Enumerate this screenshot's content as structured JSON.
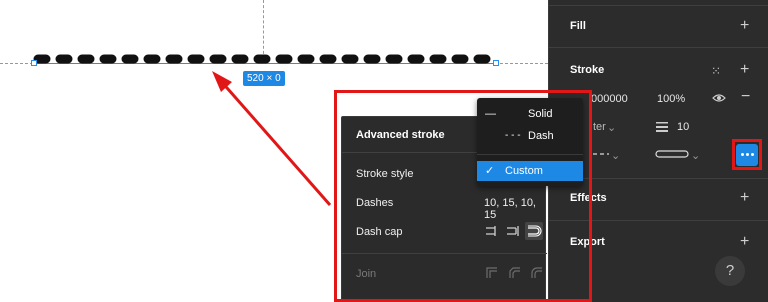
{
  "canvas": {
    "size_badge": "520 × 0"
  },
  "panel": {
    "fill": {
      "label": "Fill",
      "add_icon": "plus-icon"
    },
    "stroke": {
      "label": "Stroke",
      "color_value": "000000",
      "opacity": "100%",
      "weight": "10",
      "position_label": "ter",
      "grid_icon": "grid-dots-icon",
      "add_icon": "plus-icon",
      "eye_icon": "eye-icon",
      "remove_icon": "minus-icon",
      "more_icon": "ellipsis-icon"
    },
    "effects": {
      "label": "Effects"
    },
    "export": {
      "label": "Export"
    },
    "help": "?"
  },
  "popup": {
    "title": "Advanced stroke",
    "stroke_style_label": "Stroke style",
    "dashes_label": "Dashes",
    "dashes_value": "10, 15, 10, 15",
    "dash_cap_label": "Dash cap",
    "join_label": "Join"
  },
  "dropdown": {
    "items": [
      {
        "label": "Solid",
        "mark": "—"
      },
      {
        "label": "Dash",
        "mark": "- - -"
      },
      {
        "label": "Custom",
        "mark": "✓"
      }
    ]
  },
  "colors": {
    "accent": "#1e88e5",
    "annotation_red": "#e11717",
    "panel_bg": "#2c2c2c"
  }
}
